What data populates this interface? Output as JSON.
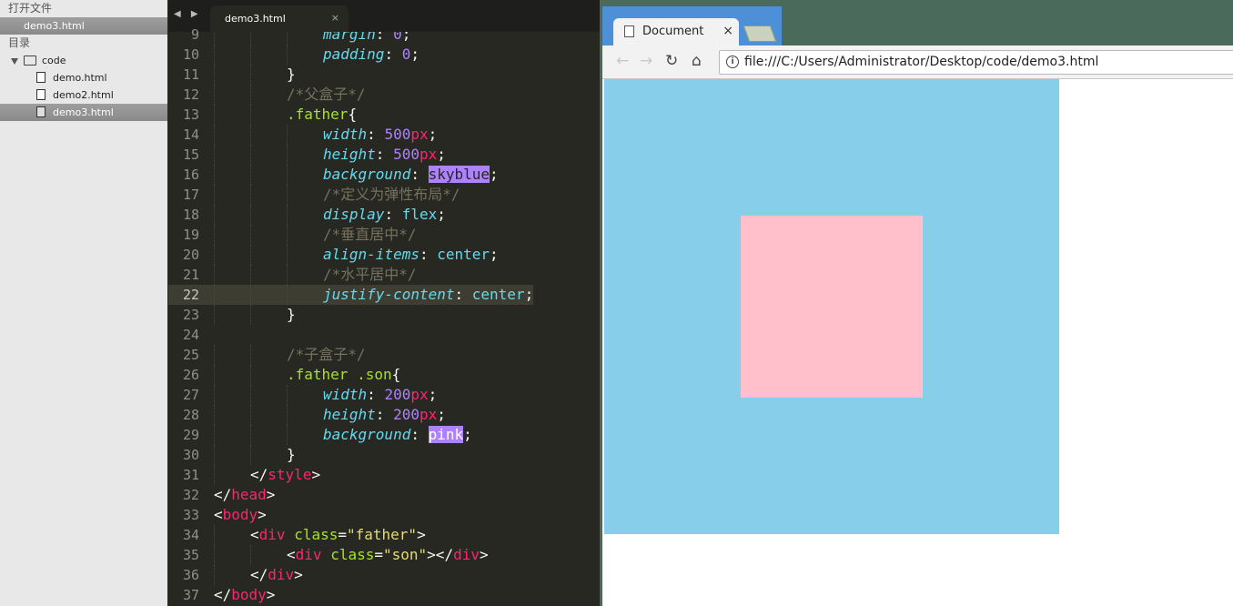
{
  "sidebar": {
    "open_files_label": "打开文件",
    "open_files": [
      {
        "name": "demo3.html"
      }
    ],
    "folders_label": "目录",
    "folder": {
      "name": "code"
    },
    "files": [
      {
        "name": "demo.html"
      },
      {
        "name": "demo2.html"
      },
      {
        "name": "demo3.html"
      }
    ]
  },
  "editor": {
    "tab_title": "demo3.html",
    "tab_close": "×",
    "tab_arrows": "◀ ▶",
    "current_line": 22,
    "lines": [
      {
        "n": 9,
        "indent": 3,
        "parts": [
          [
            "margin",
            "prop"
          ],
          [
            ": ",
            "txt"
          ],
          [
            "0",
            "num"
          ],
          [
            ";",
            "txt"
          ]
        ]
      },
      {
        "n": 10,
        "indent": 3,
        "parts": [
          [
            "padding",
            "prop"
          ],
          [
            ": ",
            "txt"
          ],
          [
            "0",
            "num"
          ],
          [
            ";",
            "txt"
          ]
        ]
      },
      {
        "n": 11,
        "indent": 2,
        "parts": [
          [
            "}",
            "txt"
          ]
        ]
      },
      {
        "n": 12,
        "indent": 2,
        "parts": [
          [
            "/*父盒子*/",
            "com"
          ]
        ]
      },
      {
        "n": 13,
        "indent": 2,
        "parts": [
          [
            ".father",
            "sel"
          ],
          [
            "{",
            "txt"
          ]
        ]
      },
      {
        "n": 14,
        "indent": 3,
        "parts": [
          [
            "width",
            "prop"
          ],
          [
            ": ",
            "txt"
          ],
          [
            "500",
            "num"
          ],
          [
            "px",
            "unit"
          ],
          [
            ";",
            "txt"
          ]
        ]
      },
      {
        "n": 15,
        "indent": 3,
        "parts": [
          [
            "height",
            "prop"
          ],
          [
            ": ",
            "txt"
          ],
          [
            "500",
            "num"
          ],
          [
            "px",
            "unit"
          ],
          [
            ";",
            "txt"
          ]
        ]
      },
      {
        "n": 16,
        "indent": 3,
        "parts": [
          [
            "background",
            "prop"
          ],
          [
            ": ",
            "txt"
          ],
          [
            "skyblue",
            "hl"
          ],
          [
            ";",
            "txt"
          ]
        ]
      },
      {
        "n": 17,
        "indent": 3,
        "parts": [
          [
            "/*定义为弹性布局*/",
            "com"
          ]
        ]
      },
      {
        "n": 18,
        "indent": 3,
        "parts": [
          [
            "display",
            "prop"
          ],
          [
            ": ",
            "txt"
          ],
          [
            "flex",
            "kw"
          ],
          [
            ";",
            "txt"
          ]
        ]
      },
      {
        "n": 19,
        "indent": 3,
        "parts": [
          [
            "/*垂直居中*/",
            "com"
          ]
        ]
      },
      {
        "n": 20,
        "indent": 3,
        "parts": [
          [
            "align-items",
            "prop"
          ],
          [
            ": ",
            "txt"
          ],
          [
            "center",
            "kw"
          ],
          [
            ";",
            "txt"
          ]
        ]
      },
      {
        "n": 21,
        "indent": 3,
        "parts": [
          [
            "/*水平居中*/",
            "com"
          ]
        ]
      },
      {
        "n": 22,
        "indent": 3,
        "parts": [
          [
            "justify-content",
            "prop"
          ],
          [
            ": ",
            "txt"
          ],
          [
            "center",
            "kw"
          ],
          [
            ";",
            "txt"
          ]
        ]
      },
      {
        "n": 23,
        "indent": 2,
        "parts": [
          [
            "}",
            "txt"
          ]
        ]
      },
      {
        "n": 24,
        "indent": 0,
        "parts": []
      },
      {
        "n": 25,
        "indent": 2,
        "parts": [
          [
            "/*子盒子*/",
            "com"
          ]
        ]
      },
      {
        "n": 26,
        "indent": 2,
        "parts": [
          [
            ".father .son",
            "sel"
          ],
          [
            "{",
            "txt"
          ]
        ]
      },
      {
        "n": 27,
        "indent": 3,
        "parts": [
          [
            "width",
            "prop"
          ],
          [
            ": ",
            "txt"
          ],
          [
            "200",
            "num"
          ],
          [
            "px",
            "unit"
          ],
          [
            ";",
            "txt"
          ]
        ]
      },
      {
        "n": 28,
        "indent": 3,
        "parts": [
          [
            "height",
            "prop"
          ],
          [
            ": ",
            "txt"
          ],
          [
            "200",
            "num"
          ],
          [
            "px",
            "unit"
          ],
          [
            ";",
            "txt"
          ]
        ]
      },
      {
        "n": 29,
        "indent": 3,
        "parts": [
          [
            "background",
            "prop"
          ],
          [
            ": ",
            "txt"
          ],
          [
            "pink",
            "hlt"
          ],
          [
            ";",
            "txt"
          ]
        ]
      },
      {
        "n": 30,
        "indent": 2,
        "parts": [
          [
            "}",
            "txt"
          ]
        ]
      },
      {
        "n": 31,
        "indent": 1,
        "parts": [
          [
            "</",
            "txt"
          ],
          [
            "style",
            "tag"
          ],
          [
            ">",
            "txt"
          ]
        ]
      },
      {
        "n": 32,
        "indent": 0,
        "parts": [
          [
            "</",
            "txt"
          ],
          [
            "head",
            "tag"
          ],
          [
            ">",
            "txt"
          ]
        ]
      },
      {
        "n": 33,
        "indent": 0,
        "parts": [
          [
            "<",
            "txt"
          ],
          [
            "body",
            "tag"
          ],
          [
            ">",
            "txt"
          ]
        ]
      },
      {
        "n": 34,
        "indent": 1,
        "parts": [
          [
            "<",
            "txt"
          ],
          [
            "div",
            "tag"
          ],
          [
            " ",
            "txt"
          ],
          [
            "class",
            "attr"
          ],
          [
            "=",
            "txt"
          ],
          [
            "\"father\"",
            "str"
          ],
          [
            ">",
            "txt"
          ]
        ]
      },
      {
        "n": 35,
        "indent": 2,
        "parts": [
          [
            "<",
            "txt"
          ],
          [
            "div",
            "tag"
          ],
          [
            " ",
            "txt"
          ],
          [
            "class",
            "attr"
          ],
          [
            "=",
            "txt"
          ],
          [
            "\"son\"",
            "str"
          ],
          [
            "></",
            "txt"
          ],
          [
            "div",
            "tag"
          ],
          [
            ">",
            "txt"
          ]
        ]
      },
      {
        "n": 36,
        "indent": 1,
        "parts": [
          [
            "</",
            "txt"
          ],
          [
            "div",
            "tag"
          ],
          [
            ">",
            "txt"
          ]
        ]
      },
      {
        "n": 37,
        "indent": 0,
        "parts": [
          [
            "</",
            "txt"
          ],
          [
            "body",
            "tag"
          ],
          [
            ">",
            "txt"
          ]
        ]
      }
    ]
  },
  "browser": {
    "tab_title": "Document",
    "tab_close": "×",
    "url": "file:///C:/Users/Administrator/Desktop/code/demo3.html",
    "back_icon": "←",
    "forward_icon": "→",
    "reload_icon": "↻",
    "home_icon": "⌂",
    "info_icon": "i",
    "father_color": "#87ceeb",
    "son_color": "#ffc0cb"
  }
}
